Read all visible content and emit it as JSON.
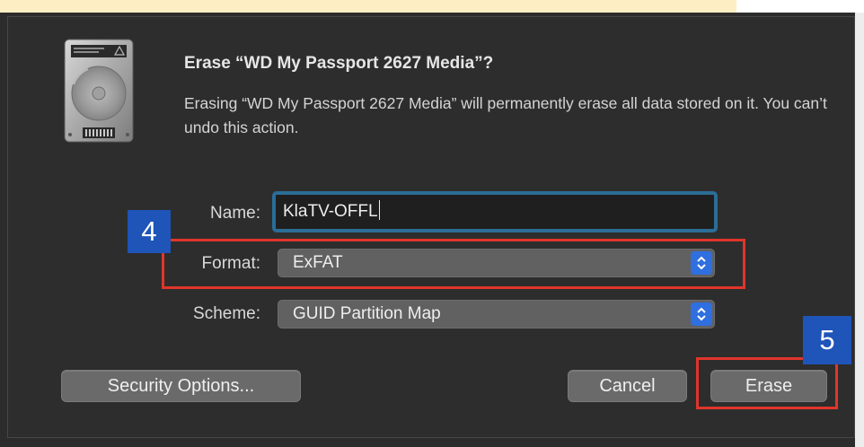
{
  "dialog": {
    "title": "Erase “WD My Passport 2627 Media”?",
    "message": "Erasing “WD My Passport 2627 Media” will permanently erase all data stored on it. You can’t undo this action.",
    "icon": "external-hard-disk-icon"
  },
  "form": {
    "name_label": "Name:",
    "name_value": "KlaTV-OFFL",
    "format_label": "Format:",
    "format_value": "ExFAT",
    "scheme_label": "Scheme:",
    "scheme_value": "GUID Partition Map"
  },
  "buttons": {
    "security_options": "Security Options...",
    "cancel": "Cancel",
    "erase": "Erase"
  },
  "annotations": {
    "step_format": "4",
    "step_erase": "5",
    "highlight_color": "#e0352b",
    "badge_color": "#1f54b8"
  },
  "colors": {
    "dialog_background": "#2d2d2d",
    "focus_ring": "#2b6d96",
    "select_arrow": "#2f6fe0"
  }
}
